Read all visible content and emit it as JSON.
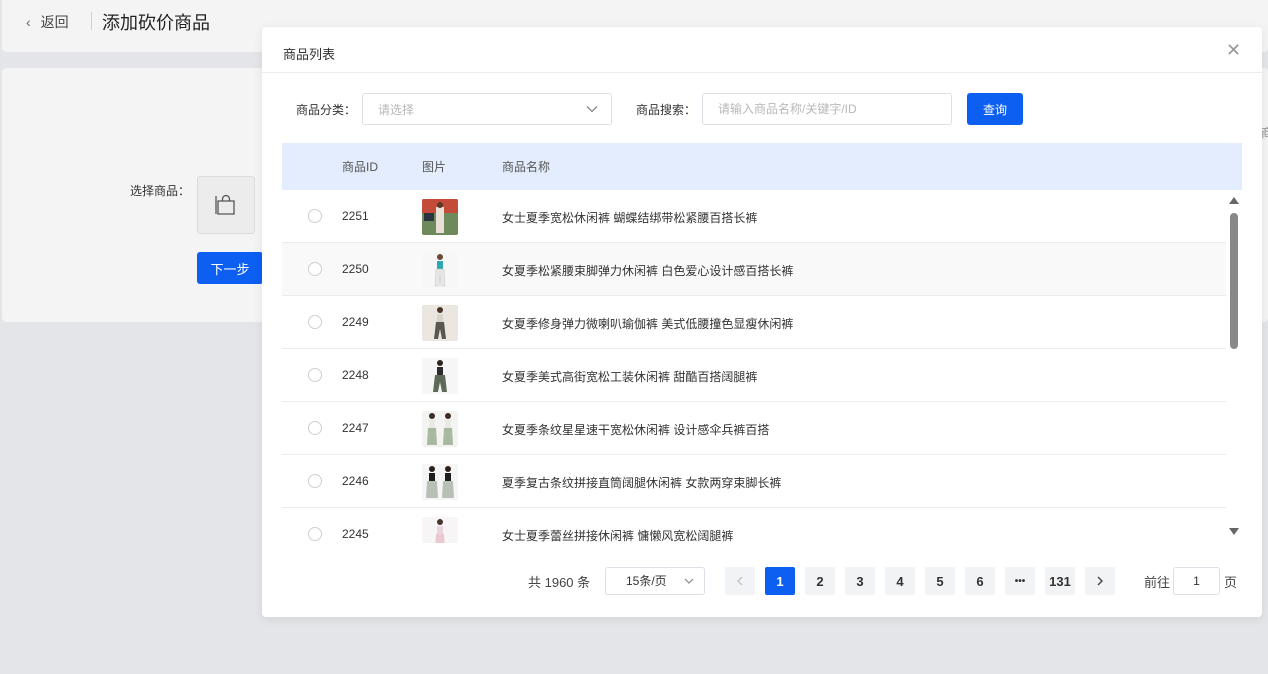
{
  "header": {
    "back_label": "返回",
    "title": "添加砍价商品"
  },
  "form": {
    "select_goods_label": "选择商品：",
    "next_button": "下一步",
    "edge_text": "商"
  },
  "modal": {
    "title": "商品列表",
    "category_label": "商品分类：",
    "category_placeholder": "请选择",
    "search_label": "商品搜索：",
    "search_placeholder": "请输入商品名称/关键字/ID",
    "query_button": "查询",
    "columns": {
      "id": "商品ID",
      "image": "图片",
      "name": "商品名称"
    },
    "rows": [
      {
        "id": "2251",
        "name": "女士夏季宽松休闲裤 蝴蝶结绑带松紧腰百搭长裤"
      },
      {
        "id": "2250",
        "name": "女夏季松紧腰束脚弹力休闲裤 白色爱心设计感百搭长裤"
      },
      {
        "id": "2249",
        "name": "女夏季修身弹力微喇叭瑜伽裤 美式低腰撞色显瘦休闲裤"
      },
      {
        "id": "2248",
        "name": "女夏季美式高街宽松工装休闲裤 甜酷百搭阔腿裤"
      },
      {
        "id": "2247",
        "name": "女夏季条纹星星速干宽松休闲裤 设计感伞兵裤百搭"
      },
      {
        "id": "2246",
        "name": "夏季复古条纹拼接直筒阔腿休闲裤 女款两穿束脚长裤"
      },
      {
        "id": "2245",
        "name": "女士夏季蕾丝拼接休闲裤 慵懒风宽松阔腿裤"
      }
    ],
    "pagination": {
      "total_text": "共 1960 条",
      "page_size": "15条/页",
      "pages": [
        "1",
        "2",
        "3",
        "4",
        "5",
        "6",
        "•••",
        "131"
      ],
      "current_page": "1",
      "goto_label": "前往",
      "goto_value": "1",
      "goto_unit": "页"
    }
  }
}
